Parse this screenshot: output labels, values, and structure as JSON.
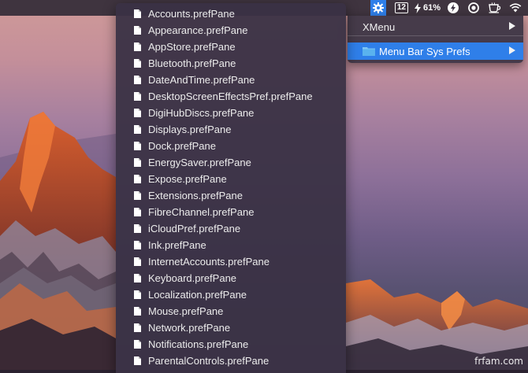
{
  "menubar": {
    "calendar_day": "12",
    "battery_percent": "61%",
    "icons": [
      "gear-icon",
      "calendar-icon",
      "battery-bolt-icon",
      "lightning-icon",
      "radio-icon",
      "coffee-cup-icon",
      "wifi-icon"
    ],
    "active_color": "#2f7fe9"
  },
  "dropdown": {
    "items": [
      {
        "label": "XMenu",
        "has_submenu": true
      },
      {
        "label": "Menu Bar Sys Prefs",
        "has_submenu": true,
        "highlighted": true,
        "icon": "folder-icon"
      }
    ]
  },
  "files": [
    "Accounts.prefPane",
    "Appearance.prefPane",
    "AppStore.prefPane",
    "Bluetooth.prefPane",
    "DateAndTime.prefPane",
    "DesktopScreenEffectsPref.prefPane",
    "DigiHubDiscs.prefPane",
    "Displays.prefPane",
    "Dock.prefPane",
    "EnergySaver.prefPane",
    "Expose.prefPane",
    "Extensions.prefPane",
    "FibreChannel.prefPane",
    "iCloudPref.prefPane",
    "Ink.prefPane",
    "InternetAccounts.prefPane",
    "Keyboard.prefPane",
    "Localization.prefPane",
    "Mouse.prefPane",
    "Network.prefPane",
    "Notifications.prefPane",
    "ParentalControls.prefPane"
  ],
  "watermark": "frfam.com"
}
